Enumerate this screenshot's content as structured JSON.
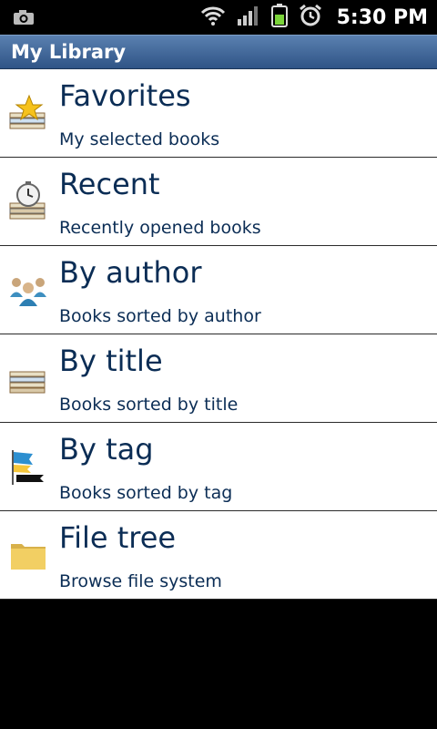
{
  "status_bar": {
    "time": "5:30 PM",
    "icons": [
      "camera-icon",
      "wifi-icon",
      "signal-icon",
      "battery-icon",
      "alarm-icon"
    ]
  },
  "title_bar": {
    "title": "My Library"
  },
  "items": [
    {
      "title": "Favorites",
      "subtitle": "My selected books",
      "icon": "star-books-icon"
    },
    {
      "title": "Recent",
      "subtitle": "Recently opened books",
      "icon": "clock-books-icon"
    },
    {
      "title": "By author",
      "subtitle": "Books sorted by author",
      "icon": "people-icon"
    },
    {
      "title": "By title",
      "subtitle": "Books sorted by title",
      "icon": "books-stack-icon"
    },
    {
      "title": "By tag",
      "subtitle": "Books sorted by tag",
      "icon": "flag-icon"
    },
    {
      "title": "File tree",
      "subtitle": "Browse file system",
      "icon": "folder-icon"
    }
  ],
  "colors": {
    "title_bar": "#3a5f93",
    "text": "#0b2d55"
  }
}
